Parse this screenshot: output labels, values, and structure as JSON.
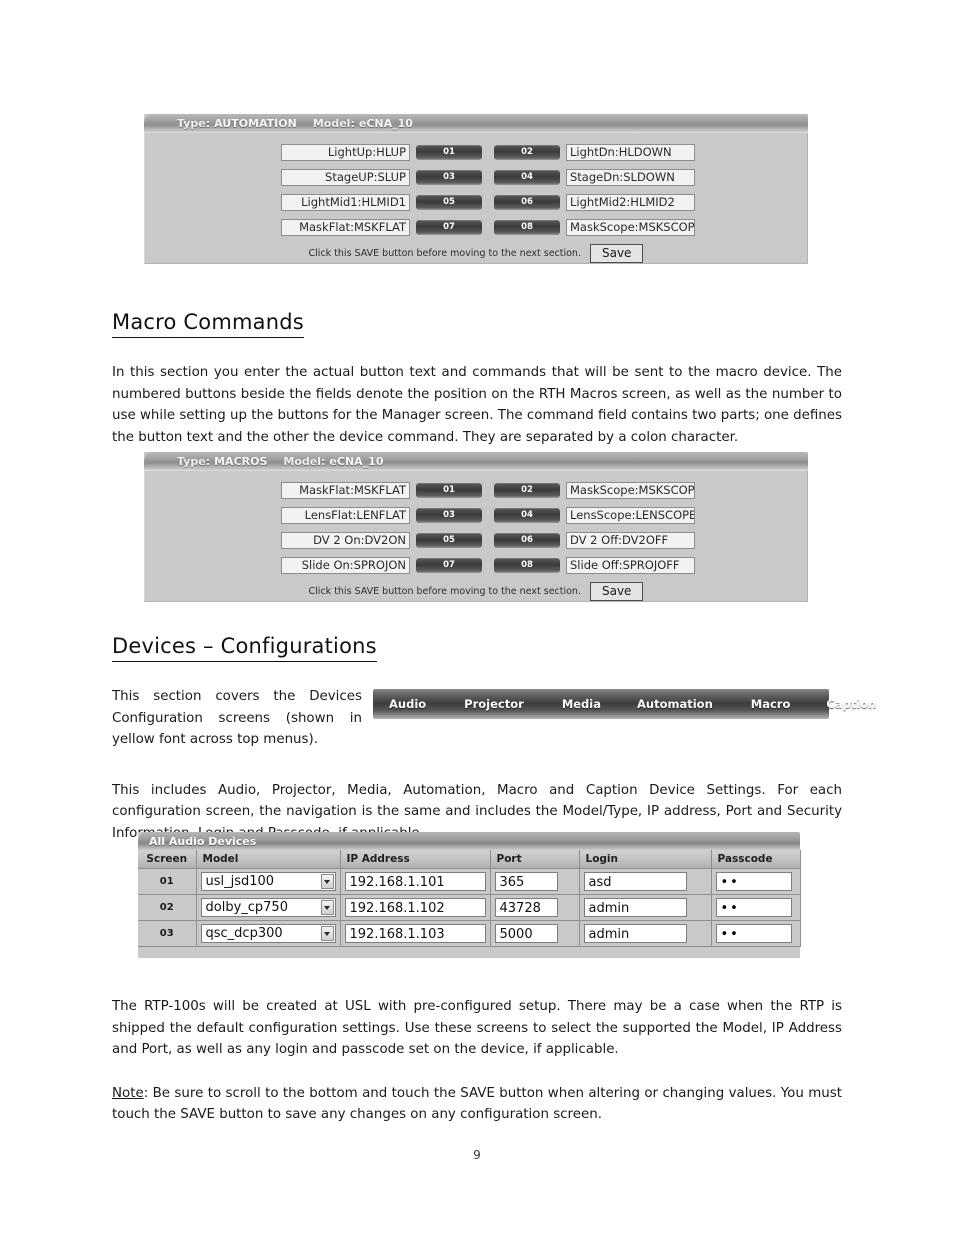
{
  "document": {
    "page_number": "9"
  },
  "panel_automation": {
    "type_label": "Type:",
    "type_value": "AUTOMATION",
    "model_label": "Model:",
    "model_value": "eCNA_10",
    "rows": [
      {
        "left": "LightUp:HLUP",
        "btn_left": "01",
        "btn_right": "02",
        "right": "LightDn:HLDOWN"
      },
      {
        "left": "StageUP:SLUP",
        "btn_left": "03",
        "btn_right": "04",
        "right": "StageDn:SLDOWN"
      },
      {
        "left": "LightMid1:HLMID1",
        "btn_left": "05",
        "btn_right": "06",
        "right": "LightMid2:HLMID2"
      },
      {
        "left": "MaskFlat:MSKFLAT",
        "btn_left": "07",
        "btn_right": "08",
        "right": "MaskScope:MSKSCOPE"
      }
    ],
    "save_note": "Click this SAVE button before moving to the next section.",
    "save_label": "Save"
  },
  "panel_macros": {
    "type_label": "Type:",
    "type_value": "MACROS",
    "model_label": "Model:",
    "model_value": "eCNA_10",
    "rows": [
      {
        "left": "MaskFlat:MSKFLAT",
        "btn_left": "01",
        "btn_right": "02",
        "right": "MaskScope:MSKSCOPE"
      },
      {
        "left": "LensFlat:LENFLAT",
        "btn_left": "03",
        "btn_right": "04",
        "right": "LensScope:LENSCOPE"
      },
      {
        "left": "DV 2 On:DV2ON",
        "btn_left": "05",
        "btn_right": "06",
        "right": "DV 2 Off:DV2OFF"
      },
      {
        "left": "Slide On:SPROJON",
        "btn_left": "07",
        "btn_right": "08",
        "right": "Slide Off:SPROJOFF"
      }
    ],
    "save_note": "Click this SAVE button before moving to the next section.",
    "save_label": "Save"
  },
  "sections": {
    "macro_commands": {
      "heading": "Macro Commands",
      "paragraph": "In this section you enter the actual button text and commands that will be sent to the macro device.  The numbered buttons beside the fields denote the position on the RTH Macros screen, as well as the number to use while setting up the buttons for the Manager screen.  The command field contains two parts; one defines the button text and the other the device command. They are separated by a colon character."
    },
    "devices_configurations": {
      "heading": "Devices – Configurations",
      "paragraph_left": "This section covers the Devices Configuration screens (shown in yellow font across top menus).",
      "paragraph_includes": "This includes Audio, Projector, Media, Automation, Macro and Caption Device Settings.  For each configuration screen, the navigation is the same and includes the Model/Type, IP address, Port and Security Information, Login and Passcode, if applicable.",
      "paragraph_rtp": "The RTP-100s will be created at USL with pre-configured setup. There may be a case when the RTP is shipped the default configuration settings.  Use these screens to select the supported the Model, IP Address and Port, as well as any login and passcode set on the device, if applicable.",
      "note_label": "Note",
      "note_text": ":  Be sure to scroll to the bottom and touch the SAVE button when altering or changing values.  You must touch the SAVE button to save any changes on any configuration screen."
    }
  },
  "navbar": {
    "items": [
      "Audio",
      "Projector",
      "Media",
      "Automation",
      "Macro",
      "Caption"
    ]
  },
  "devices_table": {
    "title": "All Audio Devices",
    "columns": [
      "Screen",
      "Model",
      "IP Address",
      "Port",
      "Login",
      "Passcode"
    ],
    "rows": [
      {
        "screen": "01",
        "model": "usl_jsd100",
        "ip": "192.168.1.101",
        "port": "365",
        "login": "asd",
        "passcode": "••"
      },
      {
        "screen": "02",
        "model": "dolby_cp750",
        "ip": "192.168.1.102",
        "port": "43728",
        "login": "admin",
        "passcode": "••"
      },
      {
        "screen": "03",
        "model": "qsc_dcp300",
        "ip": "192.168.1.103",
        "port": "5000",
        "login": "admin",
        "passcode": "••"
      }
    ]
  }
}
